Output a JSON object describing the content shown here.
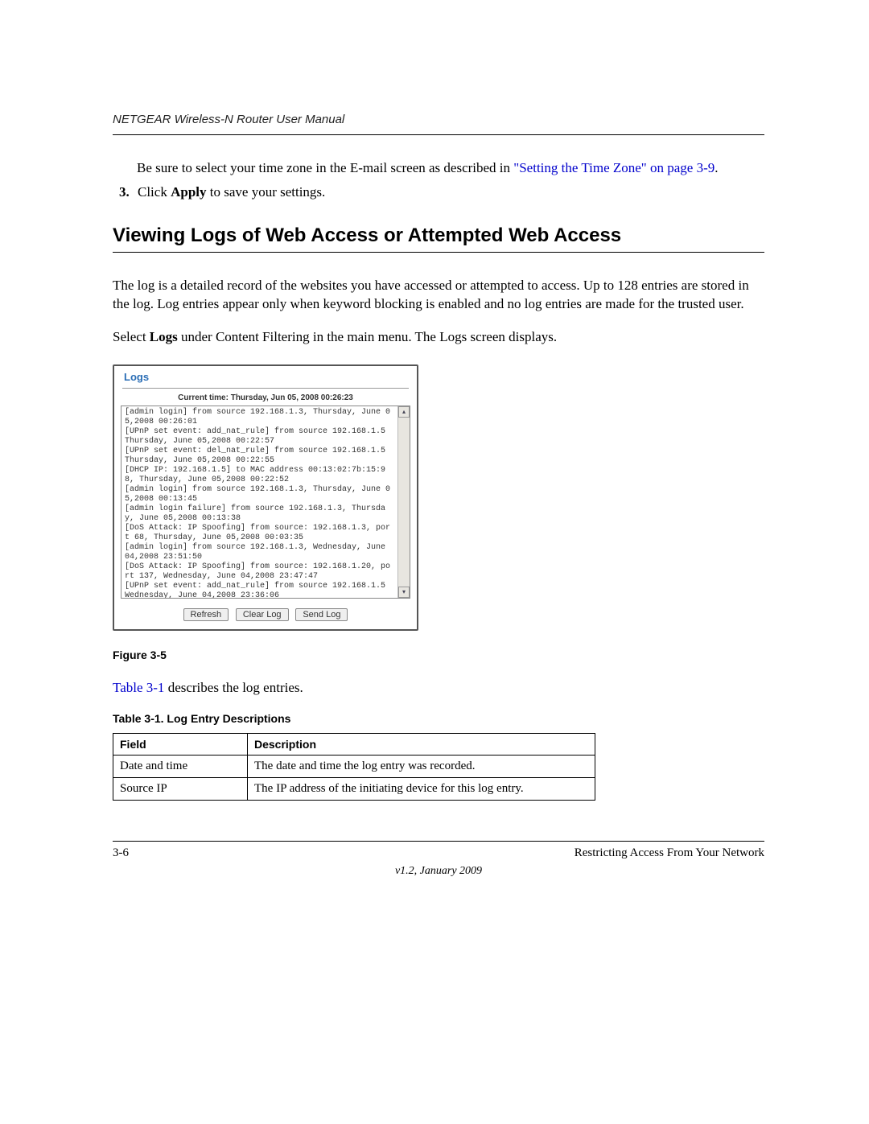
{
  "header": {
    "title": "NETGEAR Wireless-N Router User Manual"
  },
  "intro": {
    "tz_text_before": "Be sure to select your time zone in the E-mail screen as described in ",
    "tz_link": "\"Setting the Time Zone\" on page 3-9",
    "tz_text_after": "."
  },
  "step3": {
    "num": "3.",
    "text_before": "Click ",
    "bold": "Apply",
    "text_after": " to save your settings."
  },
  "section_heading": "Viewing Logs of Web Access or Attempted Web Access",
  "para1": "The log is a detailed record of the websites you have accessed or attempted to access. Up to 128 entries are stored in the log. Log entries appear only when keyword blocking is enabled and no log entries are made for the trusted user.",
  "para2": {
    "before": "Select ",
    "bold": "Logs",
    "after": " under Content Filtering in the main menu. The Logs screen displays."
  },
  "screenshot": {
    "title": "Logs",
    "current_time_label": "Current time: Thursday, Jun 05, 2008 00:26:23",
    "log_text": "[admin login] from source 192.168.1.3, Thursday, June 05,2008 00:26:01\n[UPnP set event: add_nat_rule] from source 192.168.1.5 Thursday, June 05,2008 00:22:57\n[UPnP set event: del_nat_rule] from source 192.168.1.5 Thursday, June 05,2008 00:22:55\n[DHCP IP: 192.168.1.5] to MAC address 00:13:02:7b:15:98, Thursday, June 05,2008 00:22:52\n[admin login] from source 192.168.1.3, Thursday, June 05,2008 00:13:45\n[admin login failure] from source 192.168.1.3, Thursday, June 05,2008 00:13:38\n[DoS Attack: IP Spoofing] from source: 192.168.1.3, port 68, Thursday, June 05,2008 00:03:35\n[admin login] from source 192.168.1.3, Wednesday, June 04,2008 23:51:50\n[DoS Attack: IP Spoofing] from source: 192.168.1.20, port 137, Wednesday, June 04,2008 23:47:47\n[UPnP set event: add_nat_rule] from source 192.168.1.5 Wednesday, June 04,2008 23:36:06",
    "buttons": {
      "refresh": "Refresh",
      "clear": "Clear Log",
      "send": "Send Log"
    }
  },
  "figure_caption": "Figure 3-5",
  "table_intro": {
    "link": "Table 3-1",
    "after": " describes the log entries."
  },
  "table_title": "Table 3-1.  Log Entry Descriptions",
  "table": {
    "headers": {
      "field": "Field",
      "description": "Description"
    },
    "rows": [
      {
        "field": "Date and time",
        "description": "The date and time the log entry was recorded."
      },
      {
        "field": "Source IP",
        "description": "The IP address of the initiating device for this log entry."
      }
    ]
  },
  "footer": {
    "page_num": "3-6",
    "section_title": "Restricting Access From Your Network",
    "version": "v1.2, January 2009"
  }
}
